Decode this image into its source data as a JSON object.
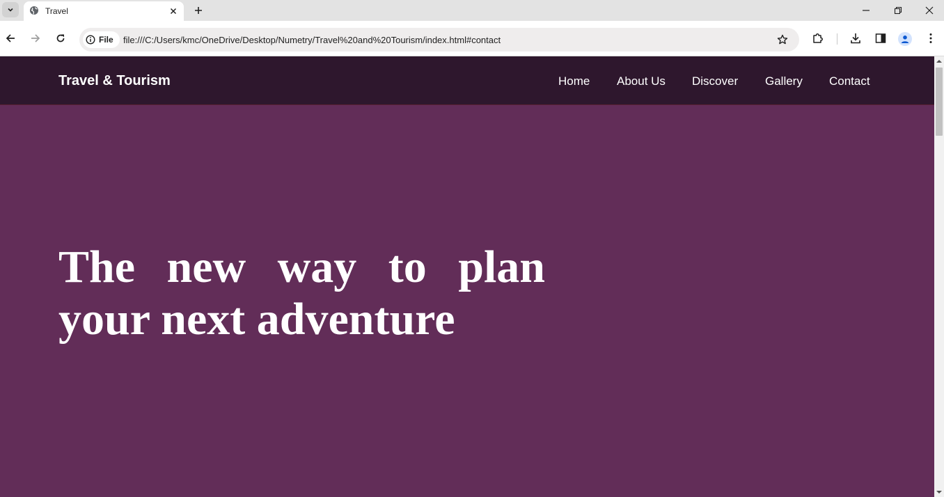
{
  "browser": {
    "tab_title": "Travel",
    "site_chip_label": "File",
    "url": "file:///C:/Users/kmc/OneDrive/Desktop/Numetry/Travel%20and%20Tourism/index.html#contact",
    "icons": {
      "tab_search": "chevron-down-icon",
      "favicon": "globe-icon",
      "tab_close": "close-icon",
      "new_tab": "plus-icon",
      "back": "arrow-left-icon",
      "forward": "arrow-right-icon",
      "reload": "reload-icon",
      "site_info": "info-icon",
      "bookmark": "star-icon",
      "extensions": "puzzle-icon",
      "downloads": "download-icon",
      "side_panel": "side-panel-icon",
      "profile": "person-icon",
      "menu": "kebab-menu-icon",
      "minimize": "minimize-icon",
      "restore": "restore-icon",
      "close_window": "close-icon"
    }
  },
  "site": {
    "brand": "Travel & Tourism",
    "nav": [
      {
        "label": "Home"
      },
      {
        "label": "About Us"
      },
      {
        "label": "Discover"
      },
      {
        "label": "Gallery"
      },
      {
        "label": "Contact"
      }
    ],
    "hero": {
      "title": "The new way to plan your next adventure"
    },
    "colors": {
      "header_bg": "#2e172d",
      "hero_bg": "#622d58",
      "text": "#ffffff"
    }
  }
}
